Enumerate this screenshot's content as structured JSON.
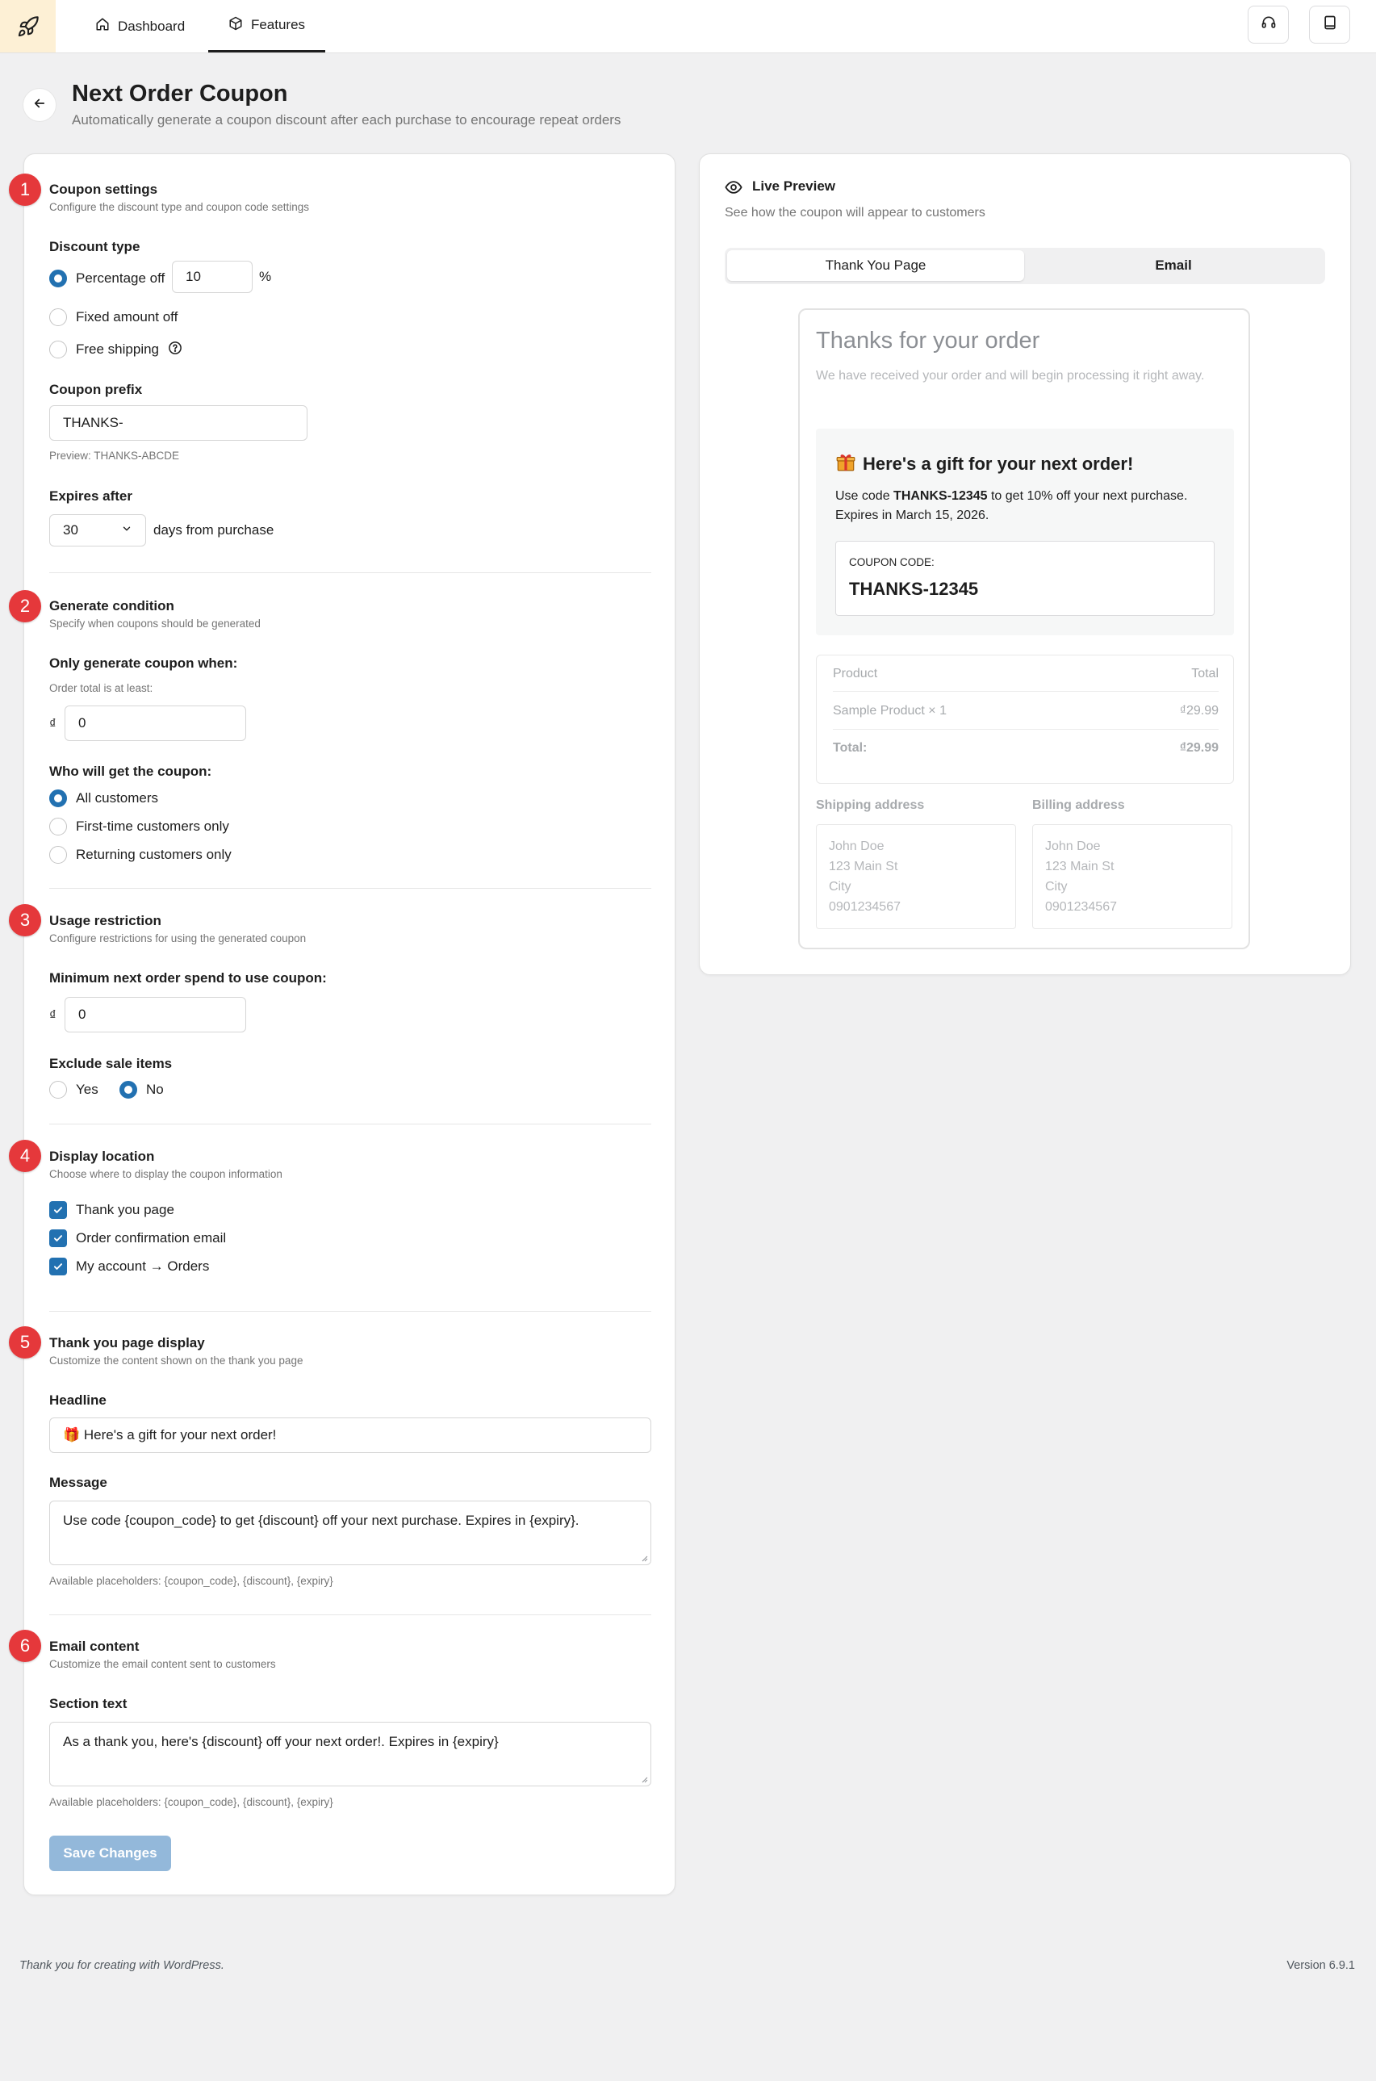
{
  "topbar": {
    "tabs": [
      {
        "label": "Dashboard",
        "icon": "home-icon"
      },
      {
        "label": "Features",
        "icon": "box-icon",
        "active": true
      }
    ],
    "actions": [
      "support-icon",
      "docs-icon"
    ]
  },
  "header": {
    "title": "Next Order Coupon",
    "subtitle": "Automatically generate a coupon discount after each purchase to encourage repeat orders"
  },
  "sections": {
    "coupon": {
      "number": "1",
      "title": "Coupon settings",
      "desc": "Configure the discount type and coupon code settings",
      "discount_type_label": "Discount type",
      "options": [
        "Percentage off",
        "Fixed amount off",
        "Free shipping"
      ],
      "selected": "Percentage off",
      "percent_value": "10",
      "percent_suffix": "%",
      "prefix_label": "Coupon prefix",
      "prefix_value": "THANKS-",
      "prefix_preview": "Preview: THANKS-ABCDE",
      "expires_label": "Expires after",
      "expires_value": "30",
      "expires_suffix": "days from purchase"
    },
    "condition": {
      "number": "2",
      "title": "Generate condition",
      "desc": "Specify when coupons should be generated",
      "only_label": "Only generate coupon when:",
      "min_total_hint": "Order total is at least:",
      "currency": "₫",
      "min_total_value": "0",
      "who_label": "Who will get the coupon:",
      "who_options": [
        "All customers",
        "First-time customers only",
        "Returning customers only"
      ],
      "who_selected": "All customers"
    },
    "usage": {
      "number": "3",
      "title": "Usage restriction",
      "desc": "Configure restrictions for using the generated coupon",
      "min_spend_label": "Minimum next order spend to use coupon:",
      "currency": "₫",
      "min_spend_value": "0",
      "exclude_label": "Exclude sale items",
      "yes": "Yes",
      "no": "No",
      "exclude_selected": "No"
    },
    "display": {
      "number": "4",
      "title": "Display location",
      "desc": "Choose where to display the coupon information",
      "options": [
        "Thank you page",
        "Order confirmation email",
        "My account → Orders"
      ],
      "all_checked": true
    },
    "thankyou": {
      "number": "5",
      "title": "Thank you page display",
      "desc": "Customize the content shown on the thank you page",
      "headline_label": "Headline",
      "headline_value": "🎁 Here's a gift for your next order!",
      "message_label": "Message",
      "message_value": "Use code {coupon_code} to get {discount} off your next purchase. Expires in {expiry}.",
      "placeholders_hint": "Available placeholders: {coupon_code}, {discount}, {expiry}"
    },
    "email": {
      "number": "6",
      "title": "Email content",
      "desc": "Customize the email content sent to customers",
      "section_text_label": "Section text",
      "section_text_value": "As a thank you, here's {discount} off your next order!. Expires in {expiry}",
      "placeholders_hint": "Available placeholders: {coupon_code}, {discount}, {expiry}"
    },
    "save_label": "Save Changes"
  },
  "preview": {
    "title": "Live Preview",
    "desc": "See how the coupon will appear to customers",
    "tabs": [
      "Thank You Page",
      "Email"
    ],
    "active_tab": "Thank You Page",
    "mock": {
      "heading": "Thanks for your order",
      "intro": "We have received your order and will begin processing it right away.",
      "gift_title": "Here's a gift for your next order!",
      "gift_msg_pre": "Use code ",
      "gift_code": "THANKS-12345",
      "gift_msg_post": " to get 10% off your next purchase. Expires in March 15, 2026.",
      "code_label": "COUPON CODE:",
      "code_value": "THANKS-12345",
      "table": {
        "head": [
          "Product",
          "Total"
        ],
        "row": [
          "Sample Product × 1",
          "₫29.99"
        ],
        "total": [
          "Total:",
          "₫29.99"
        ]
      },
      "shipping_label": "Shipping address",
      "billing_label": "Billing address",
      "address_lines": [
        "John Doe",
        "123 Main St",
        "City",
        "0901234567"
      ]
    }
  },
  "footer": {
    "left": "Thank you for creating with WordPress.",
    "right": "Version 6.9.1"
  }
}
